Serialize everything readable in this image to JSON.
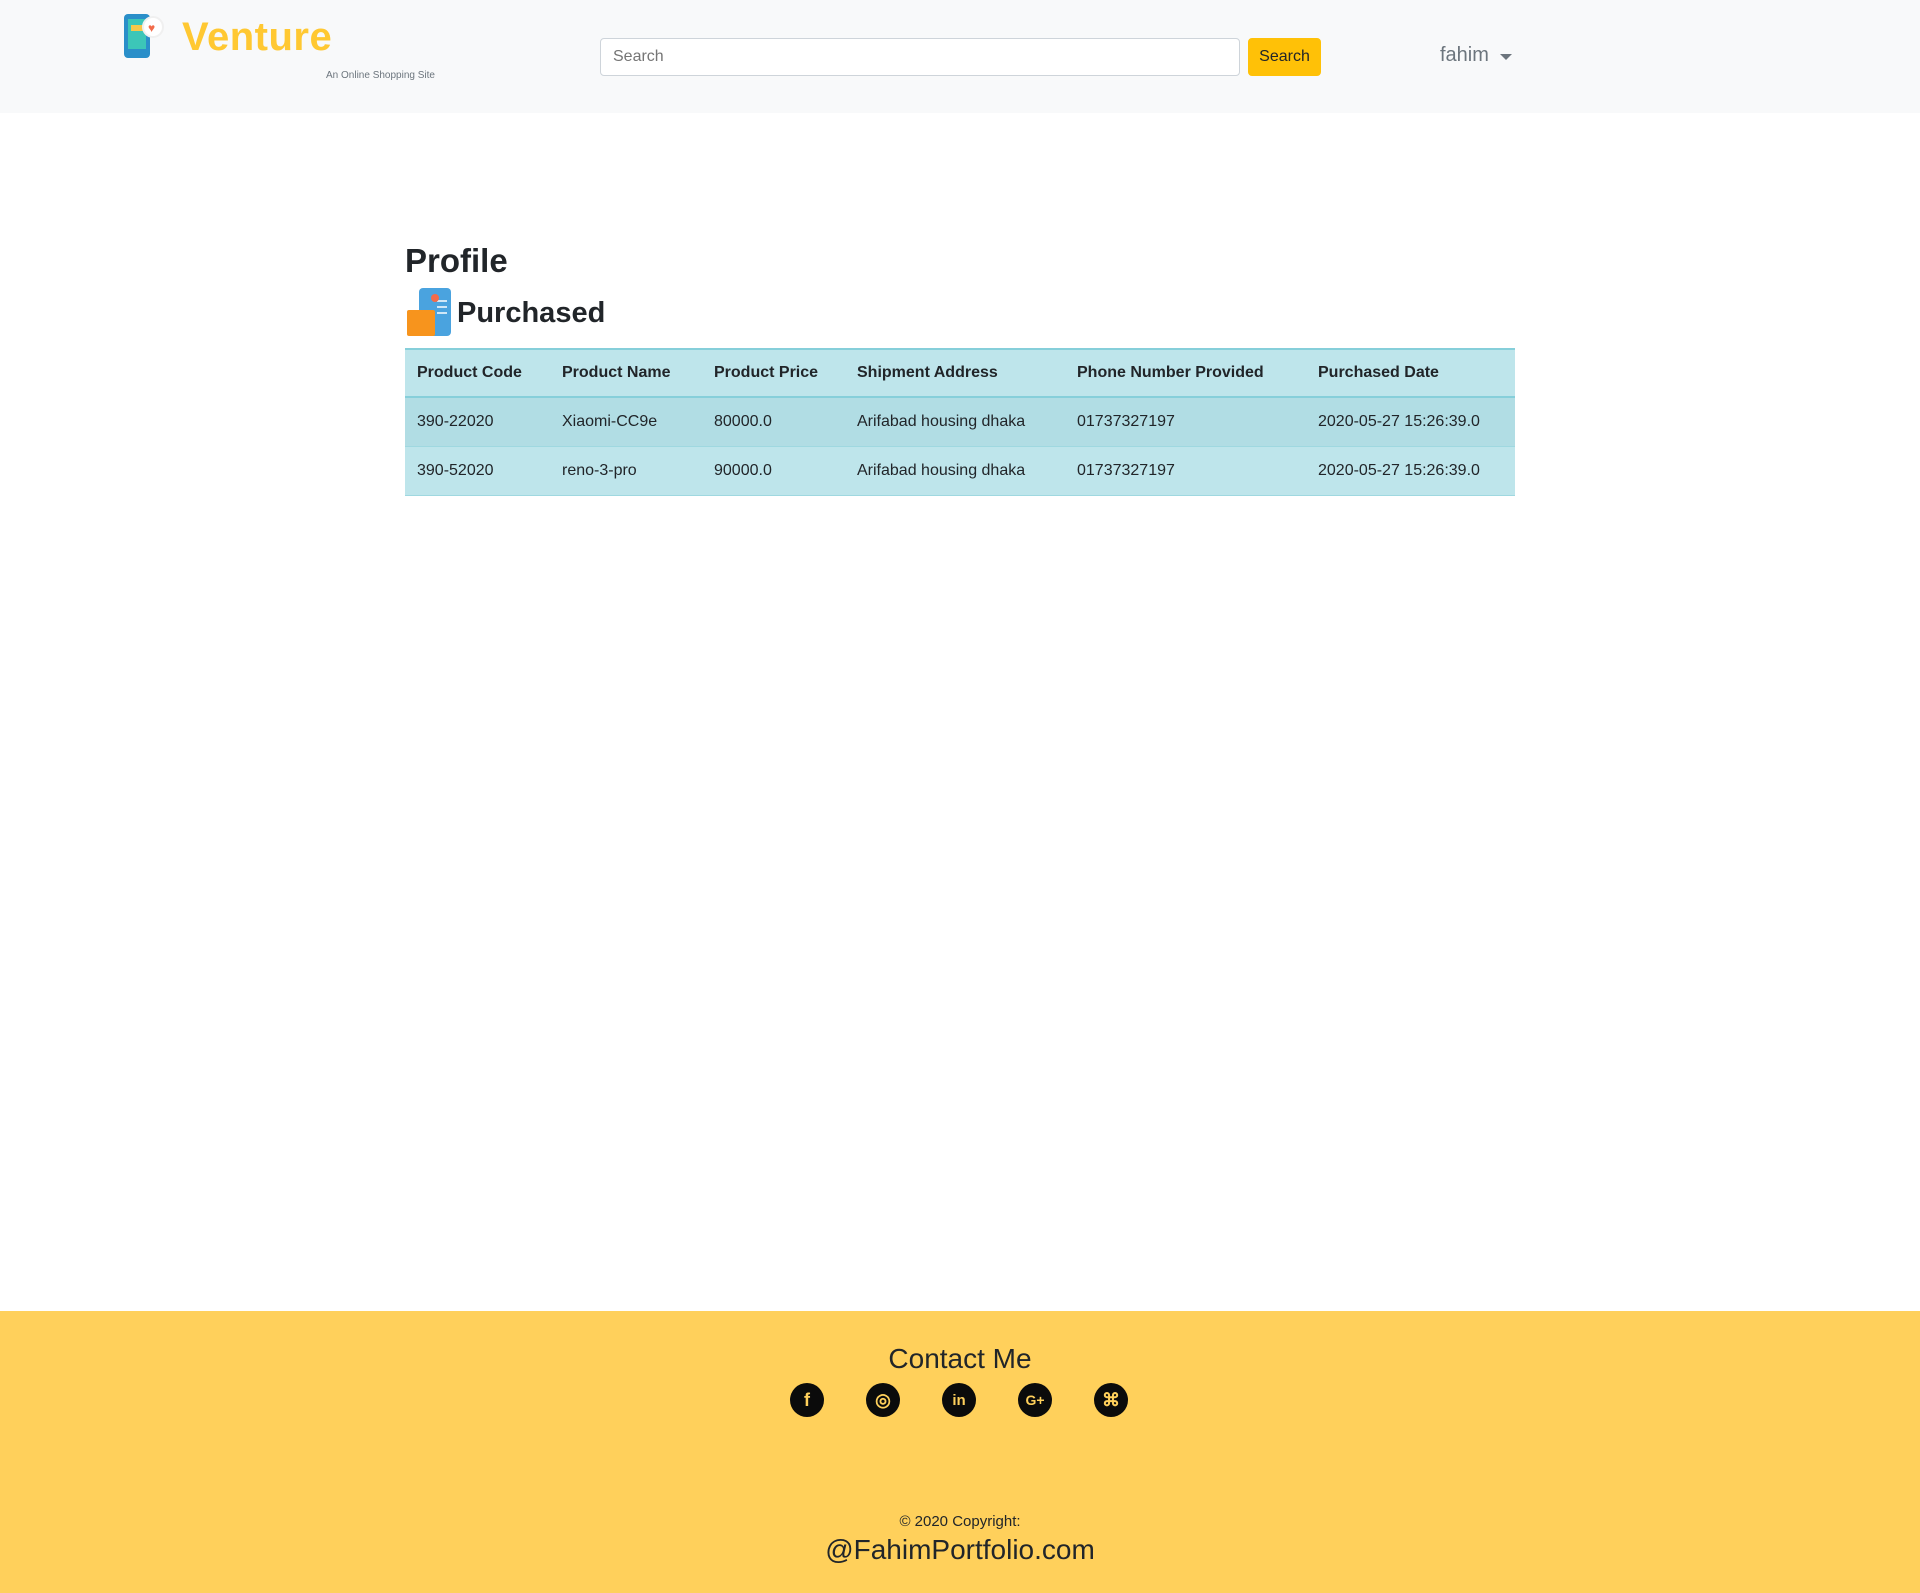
{
  "brand": {
    "name": "Venture",
    "tagline": "An Online Shopping Site"
  },
  "search": {
    "placeholder": "Search",
    "button_label": "Search"
  },
  "user": {
    "name": "fahim"
  },
  "page": {
    "title": "Profile",
    "section_title": "Purchased"
  },
  "table": {
    "headers": [
      "Product Code",
      "Product Name",
      "Product Price",
      "Shipment Address",
      "Phone Number Provided",
      "Purchased Date"
    ],
    "rows": [
      [
        "390-22020",
        "Xiaomi-CC9e",
        "80000.0",
        "Arifabad housing dhaka",
        "01737327197",
        "2020-05-27 15:26:39.0"
      ],
      [
        "390-52020",
        "reno-3-pro",
        "90000.0",
        "Arifabad housing dhaka",
        "01737327197",
        "2020-05-27 15:26:39.0"
      ]
    ]
  },
  "footer": {
    "contact_title": "Contact Me",
    "social_icons": [
      "facebook-icon",
      "instagram-icon",
      "linkedin-icon",
      "google-plus-icon",
      "github-icon"
    ],
    "copyright": "© 2020 Copyright:",
    "portfolio": "@FahimPortfolio.com"
  },
  "colors": {
    "brand": "#ffc832",
    "search_button": "#ffc107",
    "table_bg": "#bee5eb",
    "footer_bg": "#ffd05b"
  }
}
